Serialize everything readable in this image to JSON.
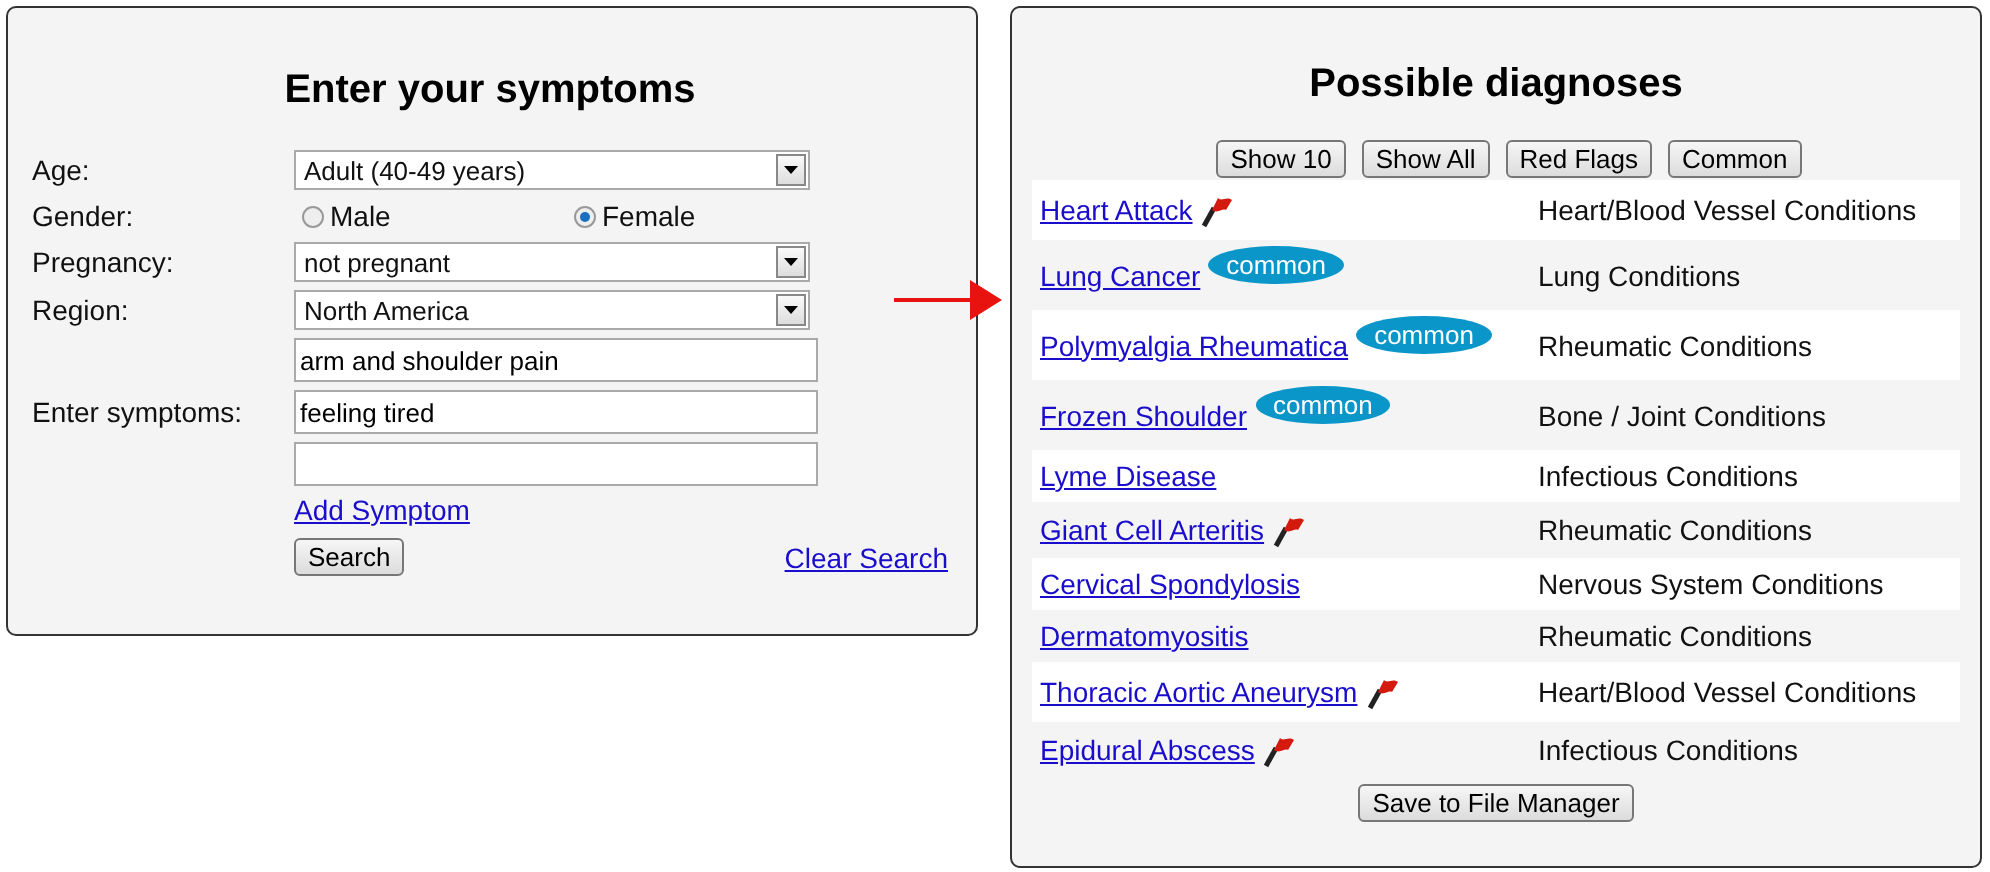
{
  "symptom_form": {
    "title": "Enter your symptoms",
    "age": {
      "label": "Age:",
      "value": "Adult (40-49 years)"
    },
    "gender": {
      "label": "Gender:",
      "options": [
        {
          "label": "Male",
          "selected": false
        },
        {
          "label": "Female",
          "selected": true
        }
      ]
    },
    "pregnancy": {
      "label": "Pregnancy:",
      "value": "not pregnant"
    },
    "region": {
      "label": "Region:",
      "value": "North America"
    },
    "symptoms": {
      "label": "Enter symptoms:",
      "fields": [
        {
          "kind": "filled",
          "value": "arm and shoulder pain"
        },
        {
          "kind": "filled",
          "value": "feeling tired"
        },
        {
          "kind": "empty"
        }
      ]
    },
    "add_link": "Add Symptom",
    "search_button": "Search",
    "clear_link": "Clear Search"
  },
  "diagnoses": {
    "title": "Possible diagnoses",
    "filters": [
      "Show 10",
      "Show All",
      "Red Flags",
      "Common"
    ],
    "rows": [
      {
        "name": "Heart Attack",
        "red_flag": true,
        "category": "Heart/Blood Vessel Conditions"
      },
      {
        "name": "Lung Cancer",
        "red_flag": false,
        "badge": "common",
        "category": "Lung Conditions"
      },
      {
        "name": "Polymyalgia Rheumatica",
        "red_flag": false,
        "badge": "common",
        "category": "Rheumatic Conditions"
      },
      {
        "name": "Frozen Shoulder",
        "red_flag": false,
        "badge": "common",
        "category": "Bone / Joint Conditions"
      },
      {
        "name": "Lyme Disease",
        "red_flag": false,
        "category": "Infectious Conditions"
      },
      {
        "name": "Giant Cell Arteritis",
        "red_flag": true,
        "category": "Rheumatic Conditions"
      },
      {
        "name": "Cervical Spondylosis",
        "red_flag": false,
        "category": "Nervous System Conditions"
      },
      {
        "name": "Dermatomyositis",
        "red_flag": false,
        "category": "Rheumatic Conditions"
      },
      {
        "name": "Thoracic Aortic Aneurysm",
        "red_flag": true,
        "category": "Heart/Blood Vessel Conditions"
      },
      {
        "name": "Epidural Abscess",
        "red_flag": true,
        "category": "Infectious Conditions"
      }
    ],
    "save_button": "Save to File Manager"
  }
}
